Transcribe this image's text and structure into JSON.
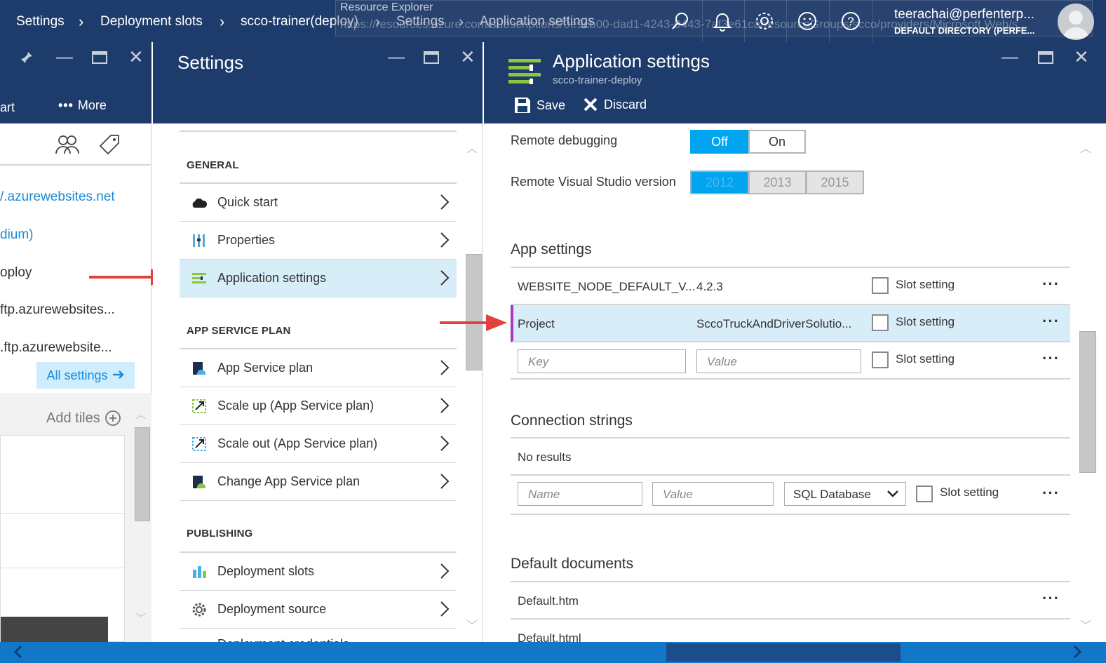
{
  "breadcrumb": [
    {
      "label": "Settings"
    },
    {
      "label": "Deployment slots"
    },
    {
      "label": "scco-trainer(deploy)"
    },
    {
      "label": "Settings"
    },
    {
      "label": "Application settings"
    }
  ],
  "overlay": {
    "title": "Resource Explorer",
    "url": "https://resources.azure.com/subscriptions/0e9cb00-dad1-4243-9443-7af3e61ca/resourceGroups/scco/providers/Microsoft.Web/s..."
  },
  "user": {
    "email": "teerachai@perfenterp...",
    "directory": "DEFAULT DIRECTORY (PERFE..."
  },
  "blade1": {
    "toolbar_partial": "art",
    "more_label": "More",
    "items": [
      "/.azurewebsites.net",
      "dium)",
      "oploy",
      "ftp.azurewebsites...",
      ".ftp.azurewebsite..."
    ],
    "all_settings": "All settings",
    "add_tiles": "Add tiles"
  },
  "blade2": {
    "title": "Settings",
    "sections": [
      {
        "header": "GENERAL",
        "items": [
          "Quick start",
          "Properties",
          "Application settings"
        ]
      },
      {
        "header": "APP SERVICE PLAN",
        "items": [
          "App Service plan",
          "Scale up (App Service plan)",
          "Scale out (App Service plan)",
          "Change App Service plan"
        ]
      },
      {
        "header": "PUBLISHING",
        "items": [
          "Deployment slots",
          "Deployment source",
          "Deployment credentials"
        ]
      }
    ]
  },
  "blade3": {
    "title": "Application settings",
    "subtitle": "scco-trainer-deploy",
    "save_label": "Save",
    "discard_label": "Discard",
    "remote_debugging": {
      "label": "Remote debugging",
      "options": [
        "Off",
        "On"
      ],
      "selected": "Off"
    },
    "remote_vs": {
      "label": "Remote Visual Studio version",
      "options": [
        "2012",
        "2013",
        "2015"
      ],
      "selected": "2012"
    },
    "app_settings": {
      "title": "App settings",
      "rows": [
        {
          "key": "WEBSITE_NODE_DEFAULT_V...",
          "value": "4.2.3",
          "slot": "Slot setting"
        },
        {
          "key": "Project",
          "value": "SccoTruckAndDriverSolutio...",
          "slot": "Slot setting"
        }
      ],
      "new_key_placeholder": "Key",
      "new_value_placeholder": "Value",
      "new_slot": "Slot setting"
    },
    "connection_strings": {
      "title": "Connection strings",
      "empty": "No results",
      "name_placeholder": "Name",
      "value_placeholder": "Value",
      "type_selected": "SQL Database",
      "slot": "Slot setting"
    },
    "default_documents": {
      "title": "Default documents",
      "rows": [
        "Default.htm",
        "Default.html"
      ]
    }
  },
  "colors": {
    "topbar": "#1e3c6b",
    "accent": "#00a4ef",
    "link": "#1b8ad7",
    "arrow": "#e2423b",
    "highlight_border": "#a33ac1"
  }
}
